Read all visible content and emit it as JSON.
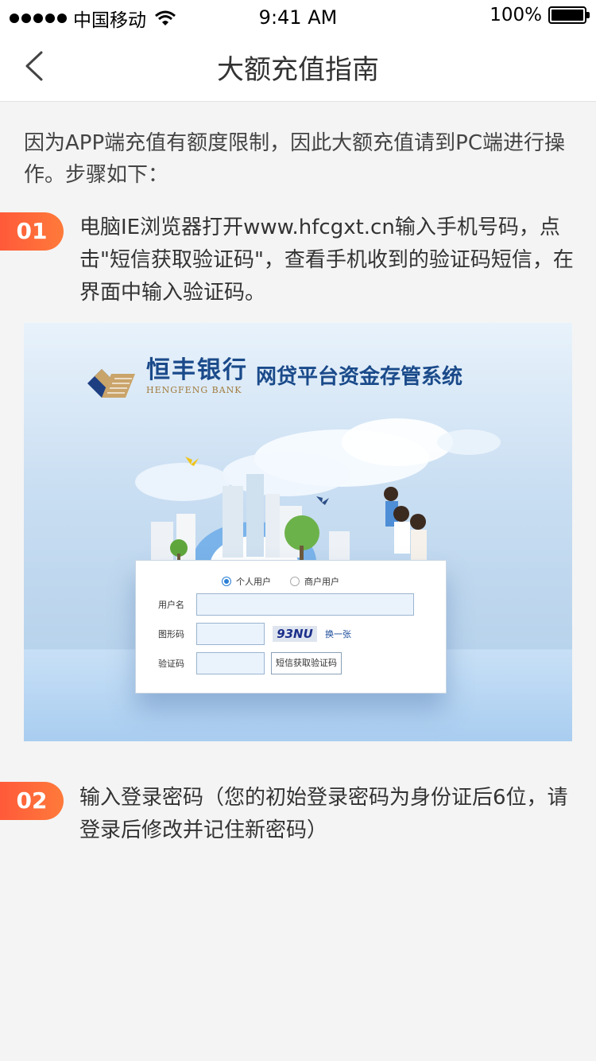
{
  "status_bar": {
    "carrier": "中国移动",
    "time": "9:41 AM",
    "battery": "100%"
  },
  "nav": {
    "title": "大额充值指南"
  },
  "intro": "因为APP端充值有额度限制，因此大额充值请到PC端进行操作。步骤如下：",
  "steps": [
    {
      "number": "01",
      "text": "电脑IE浏览器打开www.hfcgxt.cn输入手机号码，点击\"短信获取验证码\"，查看手机收到的验证码短信，在界面中输入验证码。"
    },
    {
      "number": "02",
      "text": "输入登录密码（您的初始登录密码为身份证后6位，请登录后修改并记住新密码）"
    }
  ],
  "illustration": {
    "brand_cn": "恒丰银行",
    "brand_en": "HENGFENG BANK",
    "system_name": "网贷平台资金存管系统",
    "login": {
      "radio_personal": "个人用户",
      "radio_business": "商户用户",
      "username_label": "用户名",
      "captcha_label": "图形码",
      "captcha_text": "93NU",
      "refresh_label": "换一张",
      "sms_label": "验证码",
      "sms_button": "短信获取验证码"
    }
  },
  "colors": {
    "badge_start": "#ff5a3a",
    "badge_end": "#ff7a3a",
    "brand_blue": "#1a4a8a"
  }
}
